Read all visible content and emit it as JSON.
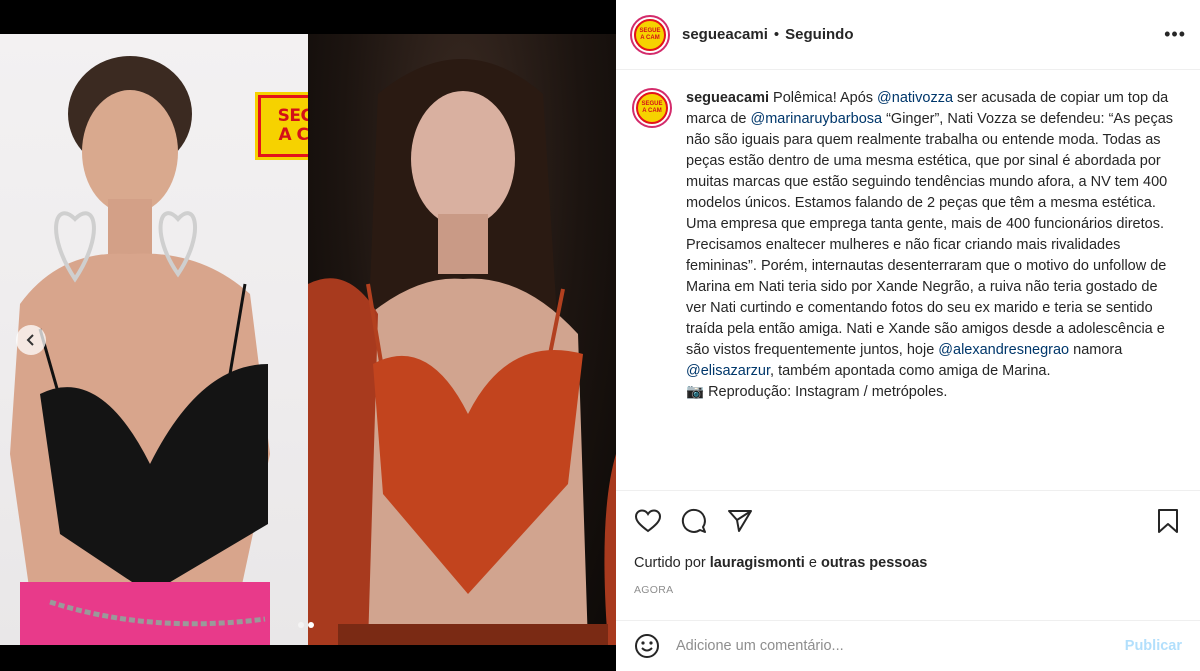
{
  "brand_badge": {
    "line1": "SEGUE",
    "line2": "A CAM"
  },
  "avatar": {
    "line1": "SEGUE",
    "line2": "A CAM"
  },
  "header": {
    "username": "segueacami",
    "separator": "•",
    "follow_status": "Seguindo",
    "more": "•••"
  },
  "caption": {
    "username": "segueacami",
    "t1": " Polêmica! Após ",
    "m1": "@nativozza",
    "t2": " ser acusada de copiar um top da marca de ",
    "m2": "@marinaruybarbosa",
    "t3": " “Ginger”, Nati Vozza se defendeu: “As peças não são iguais para quem realmente trabalha ou entende moda. Todas as peças estão dentro de uma mesma estética, que por sinal é abordada por muitas marcas que estão seguindo tendências mundo afora, a NV tem 400 modelos únicos. Estamos falando de 2 peças que têm a mesma estética. Uma empresa que emprega tanta gente, mais de 400 funcionários diretos. Precisamos enaltecer mulheres e não ficar criando mais rivalidades femininas”. Porém, internautas desenterraram que o motivo do unfollow de Marina em Nati teria sido por Xande Negrão, a ruiva não teria gostado de ver Nati curtindo e comentando fotos do seu ex marido e teria se sentido traída pela então amiga. Nati e Xande são amigos desde a adolescência e são vistos frequentemente juntos, hoje ",
    "m3": "@alexandresnegrao",
    "t4": " namora ",
    "m4": "@elisazarzur",
    "t5": ", também apontada como amiga de Marina.",
    "credit": "📷 Reprodução: Instagram / metrópoles."
  },
  "likes": {
    "prefix": "Curtido por ",
    "user": "lauragismonti",
    "middle": " e ",
    "others": "outras pessoas"
  },
  "timestamp": "AGORA",
  "comment": {
    "placeholder": "Adicione um comentário...",
    "post_label": "Publicar"
  },
  "carousel": {
    "total": 2,
    "active": 2
  }
}
